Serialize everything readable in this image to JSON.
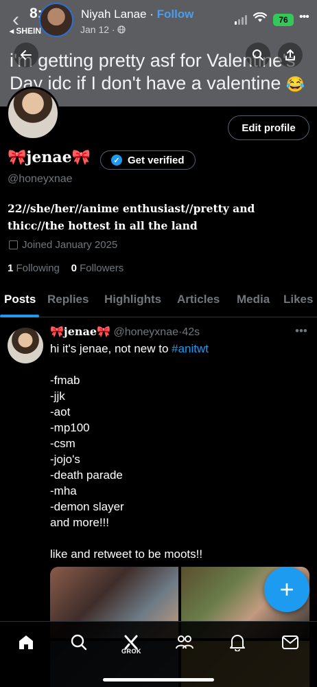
{
  "status_bar": {
    "time": "8:42",
    "back_app": "◂ SHEIN",
    "battery": "76"
  },
  "story": {
    "name": "Niyah Lanae",
    "separator": " · ",
    "follow": "Follow",
    "date": "Jan 12 ·"
  },
  "banner": {
    "text": "i'm getting pretty asf for Valentine's Day idc if I don't have a valentine",
    "emoji": "😂"
  },
  "profile": {
    "display_name": "🎀jenae🎀",
    "handle": "@honeyxnae",
    "edit_profile": "Edit profile",
    "get_verified": "Get verified",
    "bio": "22//she/her//anime enthusiast//pretty and thicc//the hottest in all the land",
    "joined": "Joined January 2025",
    "following_count": "1",
    "following_label": "Following",
    "followers_count": "0",
    "followers_label": "Followers"
  },
  "tabs": [
    "Posts",
    "Replies",
    "Highlights",
    "Articles",
    "Media",
    "Likes"
  ],
  "tweet": {
    "name": "🎀jenae🎀",
    "handle": "@honeyxnae",
    "time": "·42s",
    "text_intro": "hi it's jenae, not new to ",
    "hashtag": "#anitwt",
    "text_list": "\n\n-fmab\n-jjk\n-aot\n-mp100\n-csm\n-jojo's\n-death parade\n-mha\n-demon slayer\nand more!!!\n\nlike and retweet to be moots!!"
  },
  "bottom_nav": {
    "grok_label": "GROK"
  },
  "colors": {
    "accent": "#1d9bf0",
    "muted": "#71767b",
    "border": "#2f3336",
    "battery": "#34c759"
  },
  "icons": [
    "chevron-left-icon",
    "snowflake-icon",
    "globe-icon",
    "signal-icon",
    "wifi-icon",
    "arrow-left-icon",
    "search-icon",
    "share-icon",
    "verified-badge-icon",
    "calendar-icon",
    "more-icon",
    "plus-icon",
    "home-icon",
    "grok-icon",
    "people-icon",
    "bell-icon",
    "mail-icon"
  ]
}
